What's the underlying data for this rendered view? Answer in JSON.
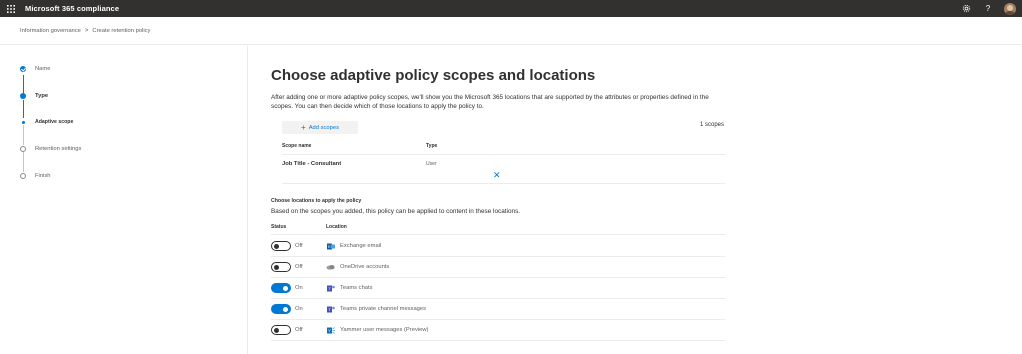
{
  "topbar": {
    "app_title": "Microsoft 365 compliance",
    "help_icon": "?",
    "settings_icon": "gear-icon"
  },
  "breadcrumb": {
    "items": [
      "Information governance",
      "Create retention policy"
    ],
    "separator": ">"
  },
  "steps": [
    {
      "label": "Name",
      "state": "done"
    },
    {
      "label": "Type",
      "state": "active"
    },
    {
      "label": "Adaptive scope",
      "state": "active-sub"
    },
    {
      "label": "Retention settings",
      "state": "pending"
    },
    {
      "label": "Finish",
      "state": "pending"
    }
  ],
  "main": {
    "title": "Choose adaptive policy scopes and locations",
    "intro": "After adding one or more adaptive policy scopes, we'll show you the Microsoft 365 locations that are supported by the attributes or properties defined in the scopes. You can then decide which of those locations to apply the policy to.",
    "add_scopes_label": "Add scopes",
    "scope_count": "1 scopes",
    "scope_table": {
      "columns": [
        "Scope name",
        "Type"
      ],
      "rows": [
        {
          "name": "Job Title - Consultant",
          "type": "User"
        }
      ]
    },
    "locations_title": "Choose locations to apply the policy",
    "locations_subtitle": "Based on the scopes you added, this policy can be applied to content in these locations.",
    "locations_columns": [
      "Status",
      "Location"
    ],
    "locations": [
      {
        "status": "Off",
        "on": false,
        "name": "Exchange email",
        "icon": "exchange-icon"
      },
      {
        "status": "Off",
        "on": false,
        "name": "OneDrive accounts",
        "icon": "onedrive-icon"
      },
      {
        "status": "On",
        "on": true,
        "name": "Teams chats",
        "icon": "teams-icon"
      },
      {
        "status": "On",
        "on": true,
        "name": "Teams private channel messages",
        "icon": "teams-icon"
      },
      {
        "status": "Off",
        "on": false,
        "name": "Yammer user messages (Preview)",
        "icon": "yammer-icon"
      }
    ]
  },
  "colors": {
    "accent": "#0078d4",
    "topbar": "#323130"
  }
}
